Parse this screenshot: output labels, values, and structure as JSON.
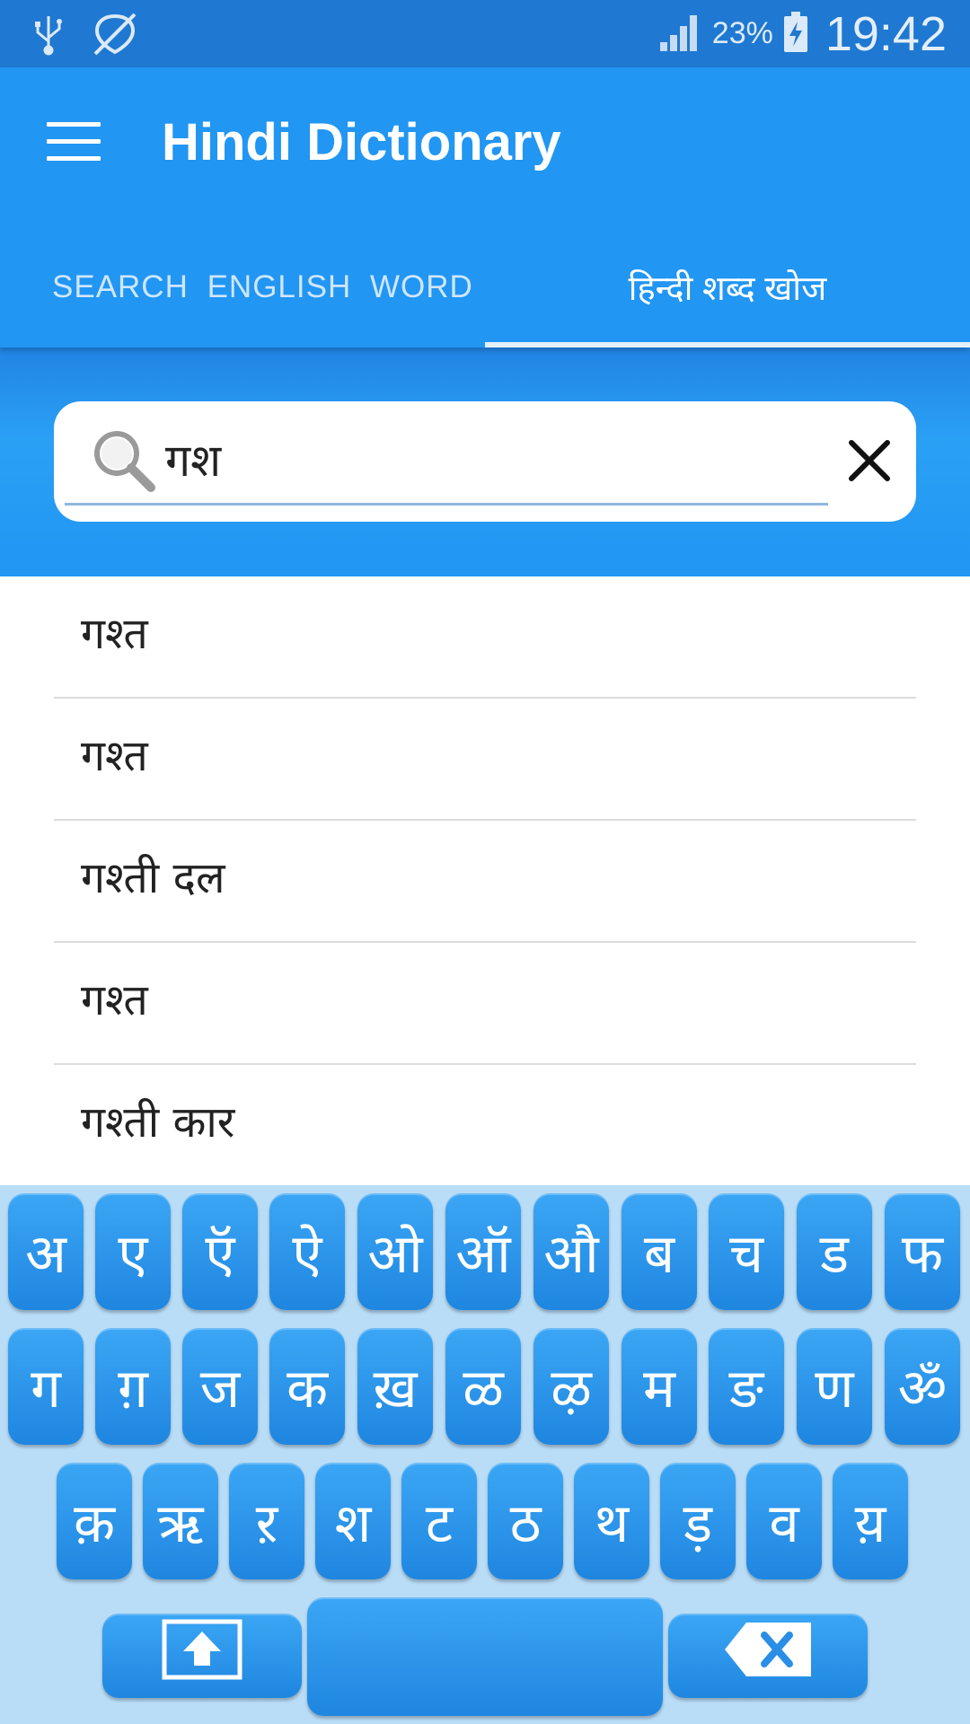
{
  "status_bar": {
    "battery_percent": "23%",
    "time": "19:42",
    "icons": [
      "usb-icon",
      "no-location-icon",
      "signal-icon",
      "battery-charging-icon"
    ]
  },
  "app_bar": {
    "title": "Hindi Dictionary",
    "menu_icon": "hamburger-menu-icon",
    "tabs": [
      {
        "label": "SEARCH  ENGLISH  WORD",
        "selected": false
      },
      {
        "label": "हिन्दी शब्द खोज",
        "selected": true
      }
    ]
  },
  "search": {
    "value": "गश",
    "icon": "search-icon",
    "clear_icon": "close-icon"
  },
  "results": [
    "गश्त",
    "गश्त",
    "गश्ती दल",
    "गश्त",
    "गश्ती कार"
  ],
  "keyboard": {
    "row1": [
      "अ",
      "ए",
      "ऍ",
      "ऐ",
      "ओ",
      "ऑ",
      "औ",
      "ब",
      "च",
      "ड",
      "फ"
    ],
    "row2": [
      "ग",
      "ग़",
      "ज",
      "क",
      "ख़",
      "ळ",
      "ऴ",
      "म",
      "ङ",
      "ण",
      "ॐ"
    ],
    "row3": [
      "क़",
      "ऋ",
      "ऱ",
      "श",
      "ट",
      "ठ",
      "थ",
      "ड़",
      "व",
      "य़"
    ],
    "shift_icon": "shift-arrow-icon",
    "backspace_icon": "backspace-icon"
  },
  "colors": {
    "status_bar": "#1f78d1",
    "primary": "#2196f3",
    "keyboard_bg": "#b9ddf7",
    "key": "#2a94ec"
  }
}
